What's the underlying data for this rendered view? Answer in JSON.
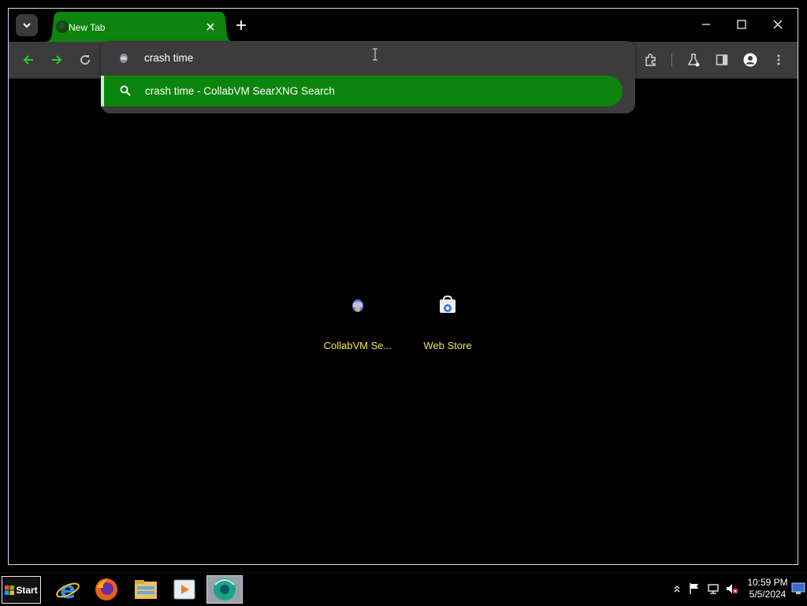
{
  "browser": {
    "tab": {
      "title": "New Tab"
    },
    "omnibox": {
      "value": "crash time",
      "suggestion": "crash time - CollabVM SearXNG Search"
    },
    "shortcuts": [
      {
        "label": "CollabVM Se...",
        "icon": "collabvm-icon"
      },
      {
        "label": "Web Store",
        "icon": "web-store-icon"
      }
    ]
  },
  "taskbar": {
    "start_label": "Start",
    "apps": [
      "internet-explorer-icon",
      "firefox-icon",
      "file-explorer-icon",
      "media-player-icon",
      "chromium-icon"
    ],
    "clock": {
      "time": "10:59 PM",
      "date": "5/5/2024"
    }
  },
  "colors": {
    "accent_green": "#0d840d",
    "toolbar_bg": "#3b3b3b",
    "shortcut_label": "#f3e35a"
  }
}
